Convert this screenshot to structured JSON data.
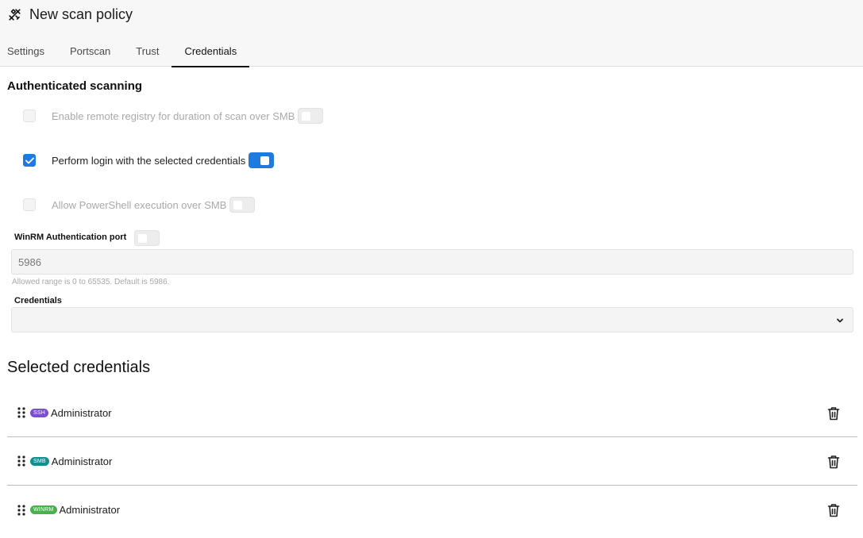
{
  "window": {
    "title": "New scan policy",
    "title_icon": "tools-icon"
  },
  "tabs": [
    {
      "label": "Settings",
      "active": false
    },
    {
      "label": "Portscan",
      "active": false
    },
    {
      "label": "Trust",
      "active": false
    },
    {
      "label": "Credentials",
      "active": true
    }
  ],
  "auth_section": {
    "title": "Authenticated scanning",
    "options": [
      {
        "label": "Enable remote registry for duration of scan over SMB",
        "checked": false,
        "enabled": false,
        "toggle_on": false
      },
      {
        "label": "Perform login with the selected credentials",
        "checked": true,
        "enabled": true,
        "toggle_on": true
      },
      {
        "label": "Allow PowerShell execution over SMB",
        "checked": false,
        "enabled": false,
        "toggle_on": false
      }
    ],
    "winrm_port": {
      "label": "WinRM Authentication port",
      "value": "5986",
      "hint": "Allowed range is 0 to 65535. Default is 5986."
    },
    "credentials_select": {
      "label": "Credentials",
      "value": ""
    }
  },
  "selected_credentials": {
    "title": "Selected credentials",
    "items": [
      {
        "type": "SSH",
        "name": "Administrator",
        "badge_color": "#7c4dcc"
      },
      {
        "type": "SMB",
        "name": "Administrator",
        "badge_color": "#0f8f8f"
      },
      {
        "type": "WINRM",
        "name": "Administrator",
        "badge_color": "#4caf50"
      }
    ]
  },
  "colors": {
    "accent": "#1f7ae0"
  }
}
